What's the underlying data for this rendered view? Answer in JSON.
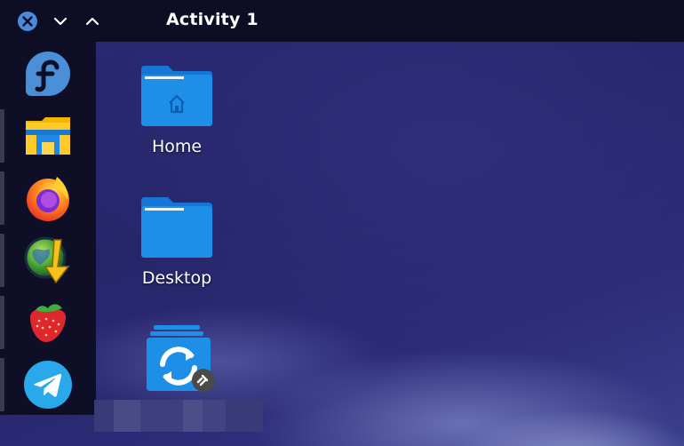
{
  "window": {
    "title": "Activity 1"
  },
  "dock": {
    "items": [
      {
        "name": "Fedora",
        "icon": "fedora-icon"
      },
      {
        "name": "Files",
        "icon": "file-manager-icon"
      },
      {
        "name": "Firefox",
        "icon": "firefox-icon"
      },
      {
        "name": "JDownloader",
        "icon": "jdownloader-icon"
      },
      {
        "name": "Strawberry",
        "icon": "strawberry-icon"
      },
      {
        "name": "Telegram",
        "icon": "telegram-icon"
      }
    ]
  },
  "desktop": {
    "icons": [
      {
        "label": "Home",
        "icon": "home-folder-icon"
      },
      {
        "label": "Desktop",
        "icon": "folder-icon"
      },
      {
        "label": "",
        "icon": "sync-folder-link-icon"
      }
    ]
  },
  "colors": {
    "topbar": "#0d0d24",
    "dock": "#0e0f26",
    "folder_blue": "#1e8fe6",
    "close_button": "#4a8ad8"
  }
}
